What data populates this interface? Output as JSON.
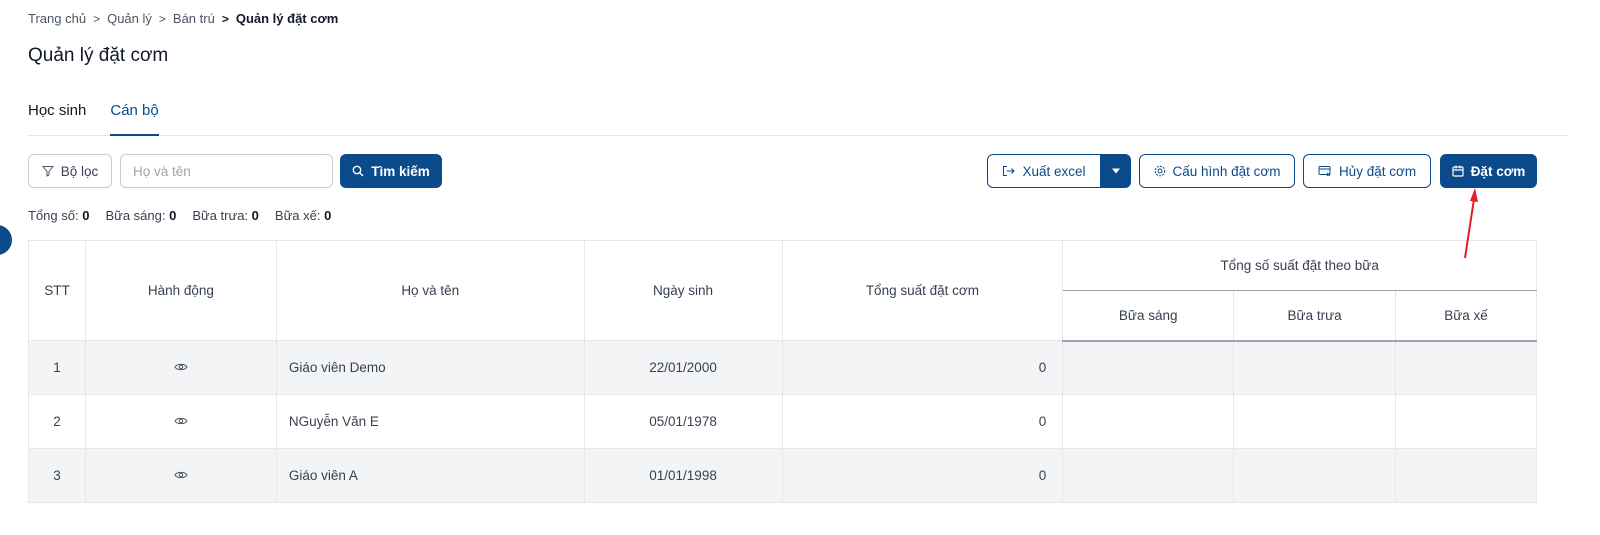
{
  "breadcrumb": [
    "Trang chủ",
    "Quản lý",
    "Bán trú",
    "Quản lý đặt cơm"
  ],
  "page_title": "Quản lý đặt cơm",
  "tabs": [
    {
      "label": "Học sinh",
      "active": false
    },
    {
      "label": "Cán bộ",
      "active": true
    }
  ],
  "toolbar": {
    "filter_label": "Bộ lọc",
    "name_placeholder": "Họ và tên",
    "search_label": "Tìm kiếm",
    "export_label": "Xuất excel",
    "config_label": "Cấu hình đặt cơm",
    "cancel_label": "Hủy đặt cơm",
    "order_label": "Đặt cơm"
  },
  "summary": {
    "total_label": "Tổng số:",
    "total_value": "0",
    "breakfast_label": "Bữa sáng:",
    "breakfast_value": "0",
    "lunch_label": "Bữa trưa:",
    "lunch_value": "0",
    "snack_label": "Bữa xế:",
    "snack_value": "0"
  },
  "table": {
    "headers": {
      "stt": "STT",
      "action": "Hành động",
      "name": "Họ và tên",
      "dob": "Ngày sinh",
      "total": "Tổng suất đặt cơm",
      "per_meal": "Tổng số suất đặt theo bữa",
      "breakfast": "Bữa sáng",
      "lunch": "Bữa trưa",
      "snack": "Bữa xế"
    },
    "rows": [
      {
        "stt": "1",
        "name": "Giáo viên Demo",
        "dob": "22/01/2000",
        "total": "0",
        "breakfast": "",
        "lunch": "",
        "snack": ""
      },
      {
        "stt": "2",
        "name": "NGuyễn Văn E",
        "dob": "05/01/1978",
        "total": "0",
        "breakfast": "",
        "lunch": "",
        "snack": ""
      },
      {
        "stt": "3",
        "name": "Giáo viên A",
        "dob": "01/01/1998",
        "total": "0",
        "breakfast": "",
        "lunch": "",
        "snack": ""
      }
    ]
  },
  "colors": {
    "primary": "#0b4a8b",
    "annotation_arrow": "#e11d2a"
  }
}
